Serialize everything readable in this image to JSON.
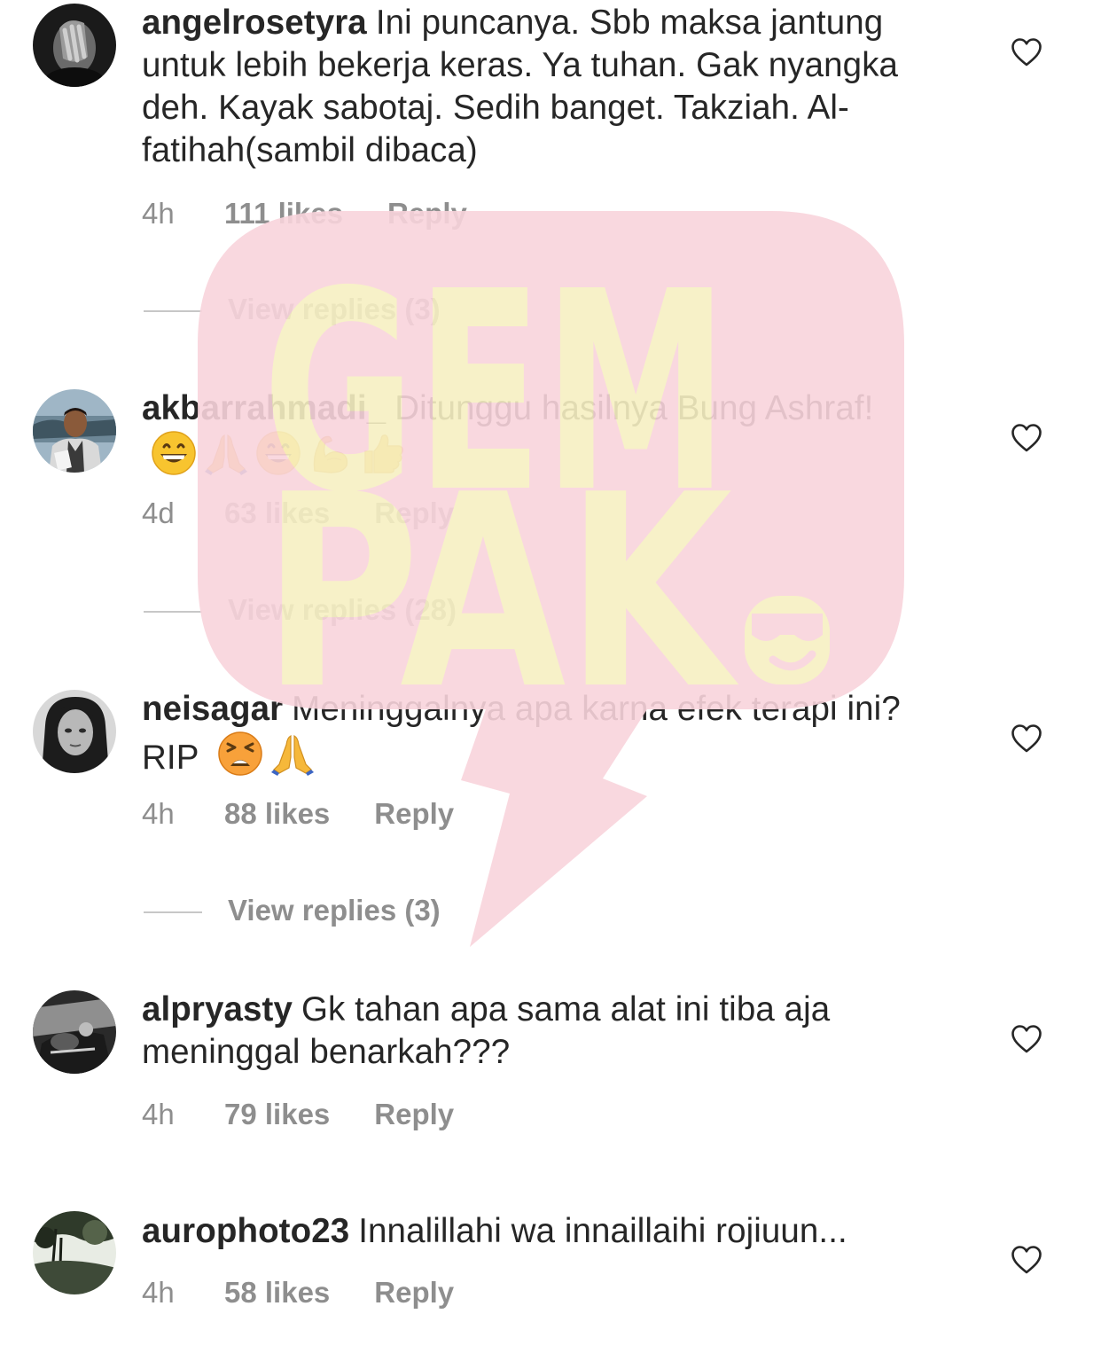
{
  "watermark": {
    "line1": "GEM",
    "line2": "PAK",
    "colors": {
      "bubble": "#f9d4dc",
      "letters": "#f7f0c2"
    }
  },
  "comments": [
    {
      "username": "angelrosetyra",
      "text": "Ini puncanya. Sbb maksa jantung untuk lebih bekerja keras. Ya tuhan. Gak nyangka deh. Kayak sabotaj. Sedih banget. Takziah. Al-fatihah(sambil dibaca)",
      "time": "4h",
      "likes": "111 likes",
      "reply": "Reply",
      "view_replies": "View replies (3)"
    },
    {
      "username": "akbarrahmadi_",
      "text": "Ditunggu hasilnya Bung Ashraf!",
      "emojis": [
        "grinning-face-emoji",
        "folded-hands-emoji",
        "grinning-face-emoji",
        "flexed-biceps-emoji",
        "thumbs-up-emoji"
      ],
      "time": "4d",
      "likes": "63 likes",
      "reply": "Reply",
      "view_replies": "View replies (28)"
    },
    {
      "username": "neisagar",
      "text": "Meninggalnya apa karna efek terapi ini? RIP",
      "emojis": [
        "tired-face-emoji",
        "folded-hands-emoji"
      ],
      "time": "4h",
      "likes": "88 likes",
      "reply": "Reply",
      "view_replies": "View replies (3)"
    },
    {
      "username": "alpryasty",
      "text": "Gk tahan apa sama alat ini tiba aja meninggal benarkah???",
      "time": "4h",
      "likes": "79 likes",
      "reply": "Reply"
    },
    {
      "username": "aurophoto23",
      "text": "Innalillahi wa innaillaihi rojiuun...",
      "time": "4h",
      "likes": "58 likes",
      "reply": "Reply"
    }
  ],
  "icons": {
    "like": "heart-outline-icon"
  },
  "colors": {
    "text": "#262626",
    "meta": "#8e8e8e",
    "divider": "#c7c7c7"
  }
}
